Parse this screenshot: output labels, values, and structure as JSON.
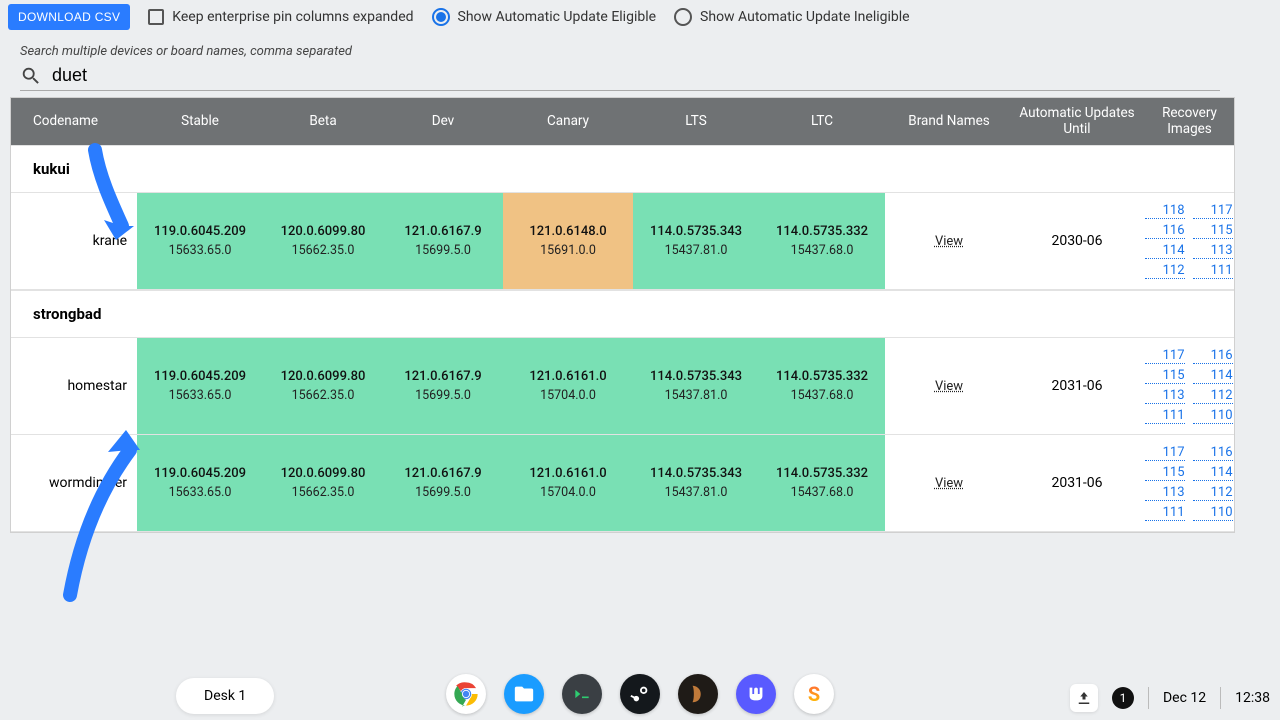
{
  "toolbar": {
    "download_label": "DOWNLOAD CSV",
    "checkbox_label": "Keep enterprise pin columns expanded",
    "radio_eligible_label": "Show Automatic Update Eligible",
    "radio_ineligible_label": "Show Automatic Update Ineligible"
  },
  "search": {
    "hint": "Search multiple devices or board names, comma separated",
    "value": "duet"
  },
  "columns": [
    "Codename",
    "Stable",
    "Beta",
    "Dev",
    "Canary",
    "LTS",
    "LTC",
    "Brand Names",
    "Automatic Updates Until",
    "Recovery Images"
  ],
  "groups": [
    {
      "name": "kukui",
      "rows": [
        {
          "codename": "krane",
          "channels": [
            {
              "v": "119.0.6045.209",
              "b": "15633.65.0",
              "c": "green"
            },
            {
              "v": "120.0.6099.80",
              "b": "15662.35.0",
              "c": "green"
            },
            {
              "v": "121.0.6167.9",
              "b": "15699.5.0",
              "c": "green"
            },
            {
              "v": "121.0.6148.0",
              "b": "15691.0.0",
              "c": "orange"
            },
            {
              "v": "114.0.5735.343",
              "b": "15437.81.0",
              "c": "green"
            },
            {
              "v": "114.0.5735.332",
              "b": "15437.68.0",
              "c": "green"
            }
          ],
          "brand": "View",
          "eol": "2030-06",
          "recovery": [
            [
              "118",
              "117"
            ],
            [
              "116",
              "115"
            ],
            [
              "114",
              "113"
            ],
            [
              "112",
              "111"
            ]
          ]
        }
      ]
    },
    {
      "name": "strongbad",
      "rows": [
        {
          "codename": "homestar",
          "channels": [
            {
              "v": "119.0.6045.209",
              "b": "15633.65.0",
              "c": "green"
            },
            {
              "v": "120.0.6099.80",
              "b": "15662.35.0",
              "c": "green"
            },
            {
              "v": "121.0.6167.9",
              "b": "15699.5.0",
              "c": "green"
            },
            {
              "v": "121.0.6161.0",
              "b": "15704.0.0",
              "c": "green"
            },
            {
              "v": "114.0.5735.343",
              "b": "15437.81.0",
              "c": "green"
            },
            {
              "v": "114.0.5735.332",
              "b": "15437.68.0",
              "c": "green"
            }
          ],
          "brand": "View",
          "eol": "2031-06",
          "recovery": [
            [
              "117",
              "116"
            ],
            [
              "115",
              "114"
            ],
            [
              "113",
              "112"
            ],
            [
              "111",
              "110"
            ]
          ]
        },
        {
          "codename": "wormdingler",
          "channels": [
            {
              "v": "119.0.6045.209",
              "b": "15633.65.0",
              "c": "green"
            },
            {
              "v": "120.0.6099.80",
              "b": "15662.35.0",
              "c": "green"
            },
            {
              "v": "121.0.6167.9",
              "b": "15699.5.0",
              "c": "green"
            },
            {
              "v": "121.0.6161.0",
              "b": "15704.0.0",
              "c": "green"
            },
            {
              "v": "114.0.5735.343",
              "b": "15437.81.0",
              "c": "green"
            },
            {
              "v": "114.0.5735.332",
              "b": "15437.68.0",
              "c": "green"
            }
          ],
          "brand": "View",
          "eol": "2031-06",
          "recovery": [
            [
              "117",
              "116"
            ],
            [
              "115",
              "114"
            ],
            [
              "113",
              "112"
            ],
            [
              "111",
              "110"
            ]
          ]
        }
      ]
    }
  ],
  "taskbar": {
    "desk_label": "Desk 1",
    "date": "Dec 12",
    "time": "12:38",
    "notif_count": "1"
  }
}
